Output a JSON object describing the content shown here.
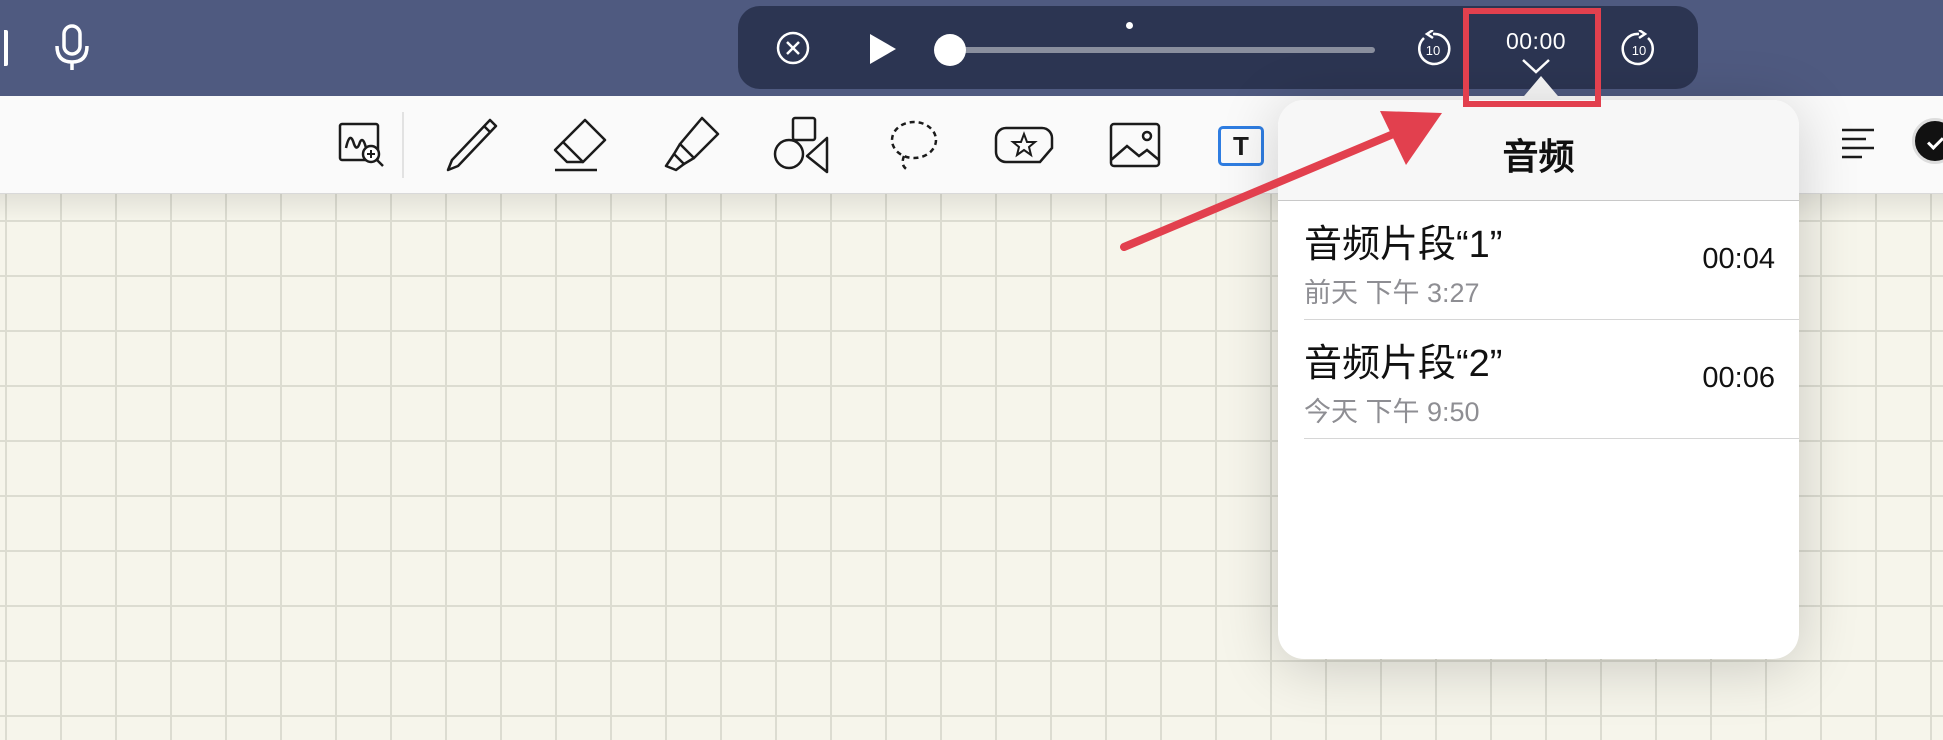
{
  "player": {
    "elapsed_time": "00:00",
    "skip_back_label": "10",
    "skip_forward_label": "10"
  },
  "toolbar": {
    "text_tool_label": "T"
  },
  "popover": {
    "title": "音频",
    "recordings": [
      {
        "name": "音频片段“1”",
        "date": "前天 下午 3:27",
        "duration": "00:04"
      },
      {
        "name": "音频片段“2”",
        "date": "今天 下午 9:50",
        "duration": "00:06"
      }
    ]
  },
  "colors": {
    "header_bg": "#4f5a80",
    "player_bg": "#2c3552",
    "highlight": "#e2404e",
    "paper": "#f6f5eb",
    "grid_line": "#dcdcd1",
    "accent_blue": "#2f7de1"
  }
}
